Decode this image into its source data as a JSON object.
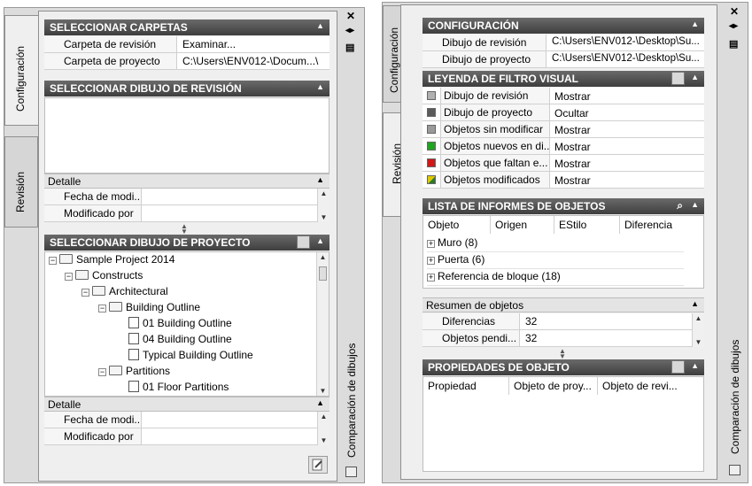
{
  "left_palette": {
    "tabs": {
      "config": "Configuración",
      "revision": "Revisión",
      "side_title": "Comparación de dibujos"
    },
    "select_folders": {
      "title": "SELECCIONAR CARPETAS",
      "rows": [
        {
          "label": "Carpeta de revisión",
          "value": "Examinar..."
        },
        {
          "label": "Carpeta de proyecto",
          "value": "C:\\Users\\ENV012-\\Docum...\\"
        }
      ]
    },
    "select_revision": {
      "title": "SELECCIONAR DIBUJO DE REVISIÓN",
      "detail": "Detalle",
      "rows": [
        {
          "label": "Fecha de modi...",
          "value": ""
        },
        {
          "label": "Modificado por",
          "value": ""
        }
      ]
    },
    "select_project": {
      "title": "SELECCIONAR DIBUJO DE PROYECTO",
      "tree": [
        {
          "label": "Sample Project 2014",
          "type": "folder"
        },
        {
          "label": "Constructs",
          "type": "folder"
        },
        {
          "label": "Architectural",
          "type": "folder"
        },
        {
          "label": "Building Outline",
          "type": "folder"
        },
        {
          "label": "01 Building Outline",
          "type": "dwg"
        },
        {
          "label": "04 Building Outline",
          "type": "dwg"
        },
        {
          "label": "Typical Building Outline",
          "type": "dwg"
        },
        {
          "label": "Partitions",
          "type": "folder"
        },
        {
          "label": "01 Floor Partitions",
          "type": "dwg"
        }
      ],
      "detail": "Detalle",
      "rows": [
        {
          "label": "Fecha de modi...",
          "value": ""
        },
        {
          "label": "Modificado por",
          "value": ""
        }
      ]
    }
  },
  "right_palette": {
    "tabs": {
      "config": "Configuración",
      "revision": "Revisión",
      "side_title": "Comparación de dibujos"
    },
    "configuration": {
      "title": "CONFIGURACIÓN",
      "rows": [
        {
          "label": "Dibujo de revisión",
          "value": "C:\\Users\\ENV012-\\Desktop\\Su..."
        },
        {
          "label": "Dibujo de proyecto",
          "value": "C:\\Users\\ENV012-\\Desktop\\Su..."
        }
      ]
    },
    "legend": {
      "title": "LEYENDA DE FILTRO VISUAL",
      "rows": [
        {
          "label": "Dibujo de revisión",
          "value": "Mostrar",
          "color": "#b0b0b0"
        },
        {
          "label": "Dibujo de proyecto",
          "value": "Ocultar",
          "color": "#5a5a5a"
        },
        {
          "label": "Objetos sin modificar",
          "value": "Mostrar",
          "color": "#9a9a9a"
        },
        {
          "label": "Objetos nuevos en di...",
          "value": "Mostrar",
          "color": "#1fa51f"
        },
        {
          "label": "Objetos que faltan e...",
          "value": "Mostrar",
          "color": "#d01818"
        },
        {
          "label": "Objetos modificados",
          "value": "Mostrar",
          "color": "#e0c800"
        }
      ]
    },
    "object_report": {
      "title": "LISTA DE INFORMES DE OBJETOS",
      "columns": [
        "Objeto",
        "Origen",
        "EStilo",
        "Diferencia"
      ],
      "items": [
        "Muro (8)",
        "Puerta (6)",
        "Referencia de bloque (18)"
      ]
    },
    "summary": {
      "title": "Resumen de objetos",
      "rows": [
        {
          "label": "Diferencias",
          "value": "32"
        },
        {
          "label": "Objetos pendi...",
          "value": "32"
        }
      ]
    },
    "properties": {
      "title": "PROPIEDADES DE OBJETO",
      "columns": [
        "Propiedad",
        "Objeto de proy...",
        "Objeto de revi..."
      ]
    }
  }
}
